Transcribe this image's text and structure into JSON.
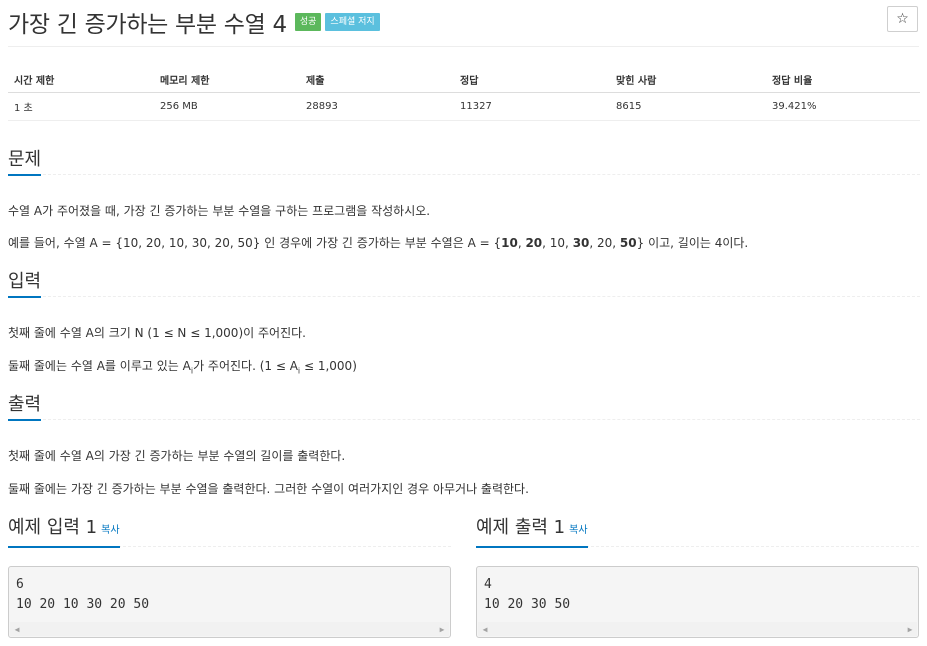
{
  "header": {
    "title": "가장 긴 증가하는 부분 수열 4",
    "badges": [
      {
        "label": "성공",
        "color": "#5cb85c"
      },
      {
        "label": "스페셜 저지",
        "color": "#5bc0de"
      }
    ],
    "star_icon": "☆"
  },
  "info_table": {
    "headers": [
      "시간 제한",
      "메모리 제한",
      "제출",
      "정답",
      "맞힌 사람",
      "정답 비율"
    ],
    "values": [
      "1 초",
      "256 MB",
      "28893",
      "11327",
      "8615",
      "39.421%"
    ]
  },
  "problem": {
    "title": "문제",
    "line1": "수열 A가 주어졌을 때, 가장 긴 증가하는 부분 수열을 구하는 프로그램을 작성하시오.",
    "line2_prefix": "예를 들어, 수열 A = {10, 20, 10, 30, 20, 50} 인 경우에 가장 긴 증가하는 부분 수열은 A = {",
    "line2_b1": "10",
    "line2_s1": ", ",
    "line2_b2": "20",
    "line2_s2": ", 10, ",
    "line2_b3": "30",
    "line2_s3": ", 20, ",
    "line2_b4": "50",
    "line2_suffix": "} 이고, 길이는 4이다."
  },
  "input": {
    "title": "입력",
    "line1": "첫째 줄에 수열 A의 크기 N (1 ≤ N ≤ 1,000)이 주어진다.",
    "line2_a": "둘째 줄에는 수열 A를 이루고 있는 A",
    "line2_sub1": "i",
    "line2_b": "가 주어진다. (1 ≤ A",
    "line2_sub2": "i",
    "line2_c": " ≤ 1,000)"
  },
  "output": {
    "title": "출력",
    "line1": "첫째 줄에 수열 A의 가장 긴 증가하는 부분 수열의 길이를 출력한다.",
    "line2": "둘째 줄에는 가장 긴 증가하는 부분 수열을 출력한다. 그러한 수열이 여러가지인 경우 아무거나 출력한다."
  },
  "sample_input": {
    "title": "예제 입력 1",
    "copy": "복사",
    "lines": [
      "6",
      "10 20 10 30 20 50"
    ]
  },
  "sample_output": {
    "title": "예제 출력 1",
    "copy": "복사",
    "lines": [
      "4",
      "10 20 30 50"
    ]
  },
  "scrollbar": {
    "left_arrow": "◀",
    "right_arrow": "▶"
  }
}
